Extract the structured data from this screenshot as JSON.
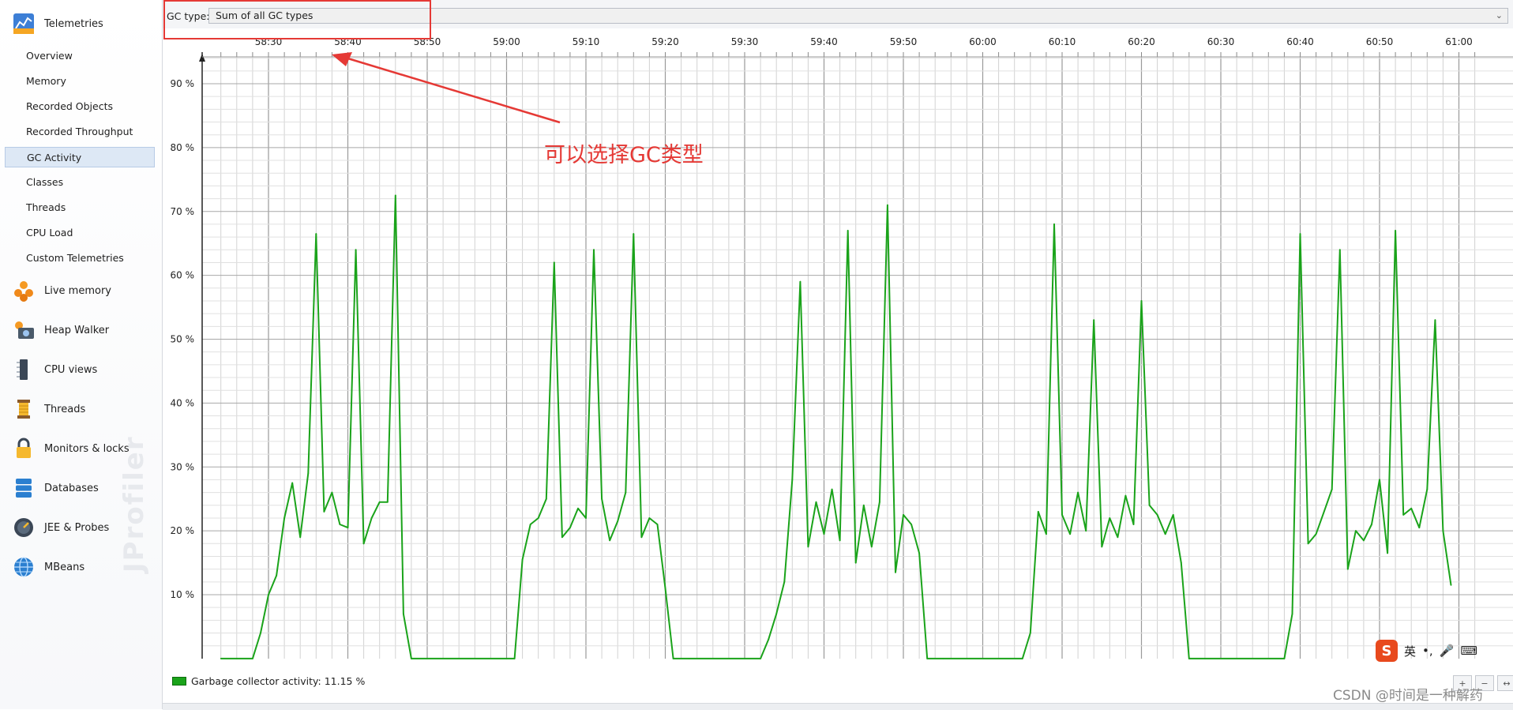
{
  "sidebar": {
    "brand": "JProfiler",
    "telemetries": {
      "label": "Telemetries"
    },
    "sub_items": [
      {
        "label": "Overview"
      },
      {
        "label": "Memory"
      },
      {
        "label": "Recorded Objects"
      },
      {
        "label": "Recorded Throughput"
      },
      {
        "label": "GC Activity",
        "selected": true
      },
      {
        "label": "Classes"
      },
      {
        "label": "Threads"
      },
      {
        "label": "CPU Load"
      },
      {
        "label": "Custom Telemetries"
      }
    ],
    "groups": [
      {
        "label": "Live memory",
        "icon": "live-memory-icon"
      },
      {
        "label": "Heap Walker",
        "icon": "heap-walker-icon"
      },
      {
        "label": "CPU views",
        "icon": "cpu-views-icon"
      },
      {
        "label": "Threads",
        "icon": "threads-icon"
      },
      {
        "label": "Monitors & locks",
        "icon": "lock-icon"
      },
      {
        "label": "Databases",
        "icon": "database-icon"
      },
      {
        "label": "JEE & Probes",
        "icon": "probe-icon"
      },
      {
        "label": "MBeans",
        "icon": "globe-icon"
      }
    ]
  },
  "toolbar": {
    "gc_type_label": "GC type:",
    "gc_type_value": "Sum of all GC types"
  },
  "annotation": "可以选择GC类型",
  "legend": {
    "label": "Garbage collector activity: 11.15 %"
  },
  "ime": {
    "lang": "英",
    "logo": "S"
  },
  "watermark": "CSDN @时间是一种解药",
  "colors": {
    "series": "#1aa31a",
    "annotation": "#e53935",
    "selection": "#dde8f5"
  },
  "chart_data": {
    "type": "line",
    "title": "",
    "xlabel": "",
    "ylabel": "",
    "x_ticks": [
      "58:30",
      "58:40",
      "58:50",
      "59:00",
      "59:10",
      "59:20",
      "59:30",
      "59:40",
      "59:50",
      "60:00",
      "60:10",
      "60:20",
      "60:30",
      "60:40",
      "60:50",
      "61:00"
    ],
    "y_ticks": [
      "10 %",
      "20 %",
      "30 %",
      "40 %",
      "50 %",
      "60 %",
      "70 %",
      "80 %",
      "90 %"
    ],
    "ylim": [
      0,
      90
    ],
    "xlim_seconds": [
      3503,
      3663
    ],
    "grid": true,
    "series": [
      {
        "name": "Garbage collector activity",
        "points": [
          [
            3504,
            0
          ],
          [
            3506,
            0
          ],
          [
            3508,
            0
          ],
          [
            3509,
            4
          ],
          [
            3510,
            10
          ],
          [
            3511,
            13
          ],
          [
            3512,
            22
          ],
          [
            3513,
            27.5
          ],
          [
            3514,
            19
          ],
          [
            3515,
            29
          ],
          [
            3516,
            66.5
          ],
          [
            3517,
            23
          ],
          [
            3518,
            26
          ],
          [
            3519,
            21
          ],
          [
            3520,
            20.5
          ],
          [
            3521,
            64
          ],
          [
            3522,
            18
          ],
          [
            3523,
            22
          ],
          [
            3524,
            24.5
          ],
          [
            3525,
            24.5
          ],
          [
            3526,
            72.5
          ],
          [
            3527,
            7
          ],
          [
            3528,
            0
          ],
          [
            3530,
            0
          ],
          [
            3540,
            0
          ],
          [
            3541,
            0
          ],
          [
            3542,
            15.5
          ],
          [
            3543,
            21
          ],
          [
            3544,
            22
          ],
          [
            3545,
            25
          ],
          [
            3546,
            62
          ],
          [
            3547,
            19
          ],
          [
            3548,
            20.5
          ],
          [
            3549,
            23.5
          ],
          [
            3550,
            22
          ],
          [
            3551,
            64
          ],
          [
            3552,
            25
          ],
          [
            3553,
            18.5
          ],
          [
            3554,
            21.5
          ],
          [
            3555,
            26
          ],
          [
            3556,
            66.5
          ],
          [
            3557,
            19
          ],
          [
            3558,
            22
          ],
          [
            3559,
            21
          ],
          [
            3560,
            11
          ],
          [
            3561,
            0
          ],
          [
            3563,
            0
          ],
          [
            3570,
            0
          ],
          [
            3572,
            0
          ],
          [
            3573,
            3
          ],
          [
            3574,
            7
          ],
          [
            3575,
            12
          ],
          [
            3576,
            28
          ],
          [
            3577,
            59
          ],
          [
            3578,
            17.5
          ],
          [
            3579,
            24.5
          ],
          [
            3580,
            19.5
          ],
          [
            3581,
            26.5
          ],
          [
            3582,
            18.5
          ],
          [
            3583,
            67
          ],
          [
            3584,
            15
          ],
          [
            3585,
            24
          ],
          [
            3586,
            17.5
          ],
          [
            3587,
            24.5
          ],
          [
            3588,
            71
          ],
          [
            3589,
            13.5
          ],
          [
            3590,
            22.5
          ],
          [
            3591,
            21
          ],
          [
            3592,
            16.5
          ],
          [
            3593,
            0
          ],
          [
            3595,
            0
          ],
          [
            3605,
            0
          ],
          [
            3606,
            4
          ],
          [
            3607,
            23
          ],
          [
            3608,
            19.5
          ],
          [
            3609,
            68
          ],
          [
            3610,
            22.5
          ],
          [
            3611,
            19.5
          ],
          [
            3612,
            26
          ],
          [
            3613,
            20
          ],
          [
            3614,
            53
          ],
          [
            3615,
            17.5
          ],
          [
            3616,
            22
          ],
          [
            3617,
            19
          ],
          [
            3618,
            25.5
          ],
          [
            3619,
            21
          ],
          [
            3620,
            56
          ],
          [
            3621,
            24
          ],
          [
            3622,
            22.5
          ],
          [
            3623,
            19.5
          ],
          [
            3624,
            22.5
          ],
          [
            3625,
            15
          ],
          [
            3626,
            0
          ],
          [
            3628,
            0
          ],
          [
            3638,
            0
          ],
          [
            3639,
            7
          ],
          [
            3640,
            66.5
          ],
          [
            3641,
            18
          ],
          [
            3642,
            19.5
          ],
          [
            3643,
            23
          ],
          [
            3644,
            26.5
          ],
          [
            3645,
            64
          ],
          [
            3646,
            14
          ],
          [
            3647,
            20
          ],
          [
            3648,
            18.5
          ],
          [
            3649,
            21
          ],
          [
            3650,
            28
          ],
          [
            3651,
            16.5
          ],
          [
            3652,
            67
          ],
          [
            3653,
            22.5
          ],
          [
            3654,
            23.5
          ],
          [
            3655,
            20.5
          ],
          [
            3656,
            26.5
          ],
          [
            3657,
            53
          ],
          [
            3658,
            20
          ],
          [
            3659,
            11.5
          ]
        ]
      }
    ]
  }
}
